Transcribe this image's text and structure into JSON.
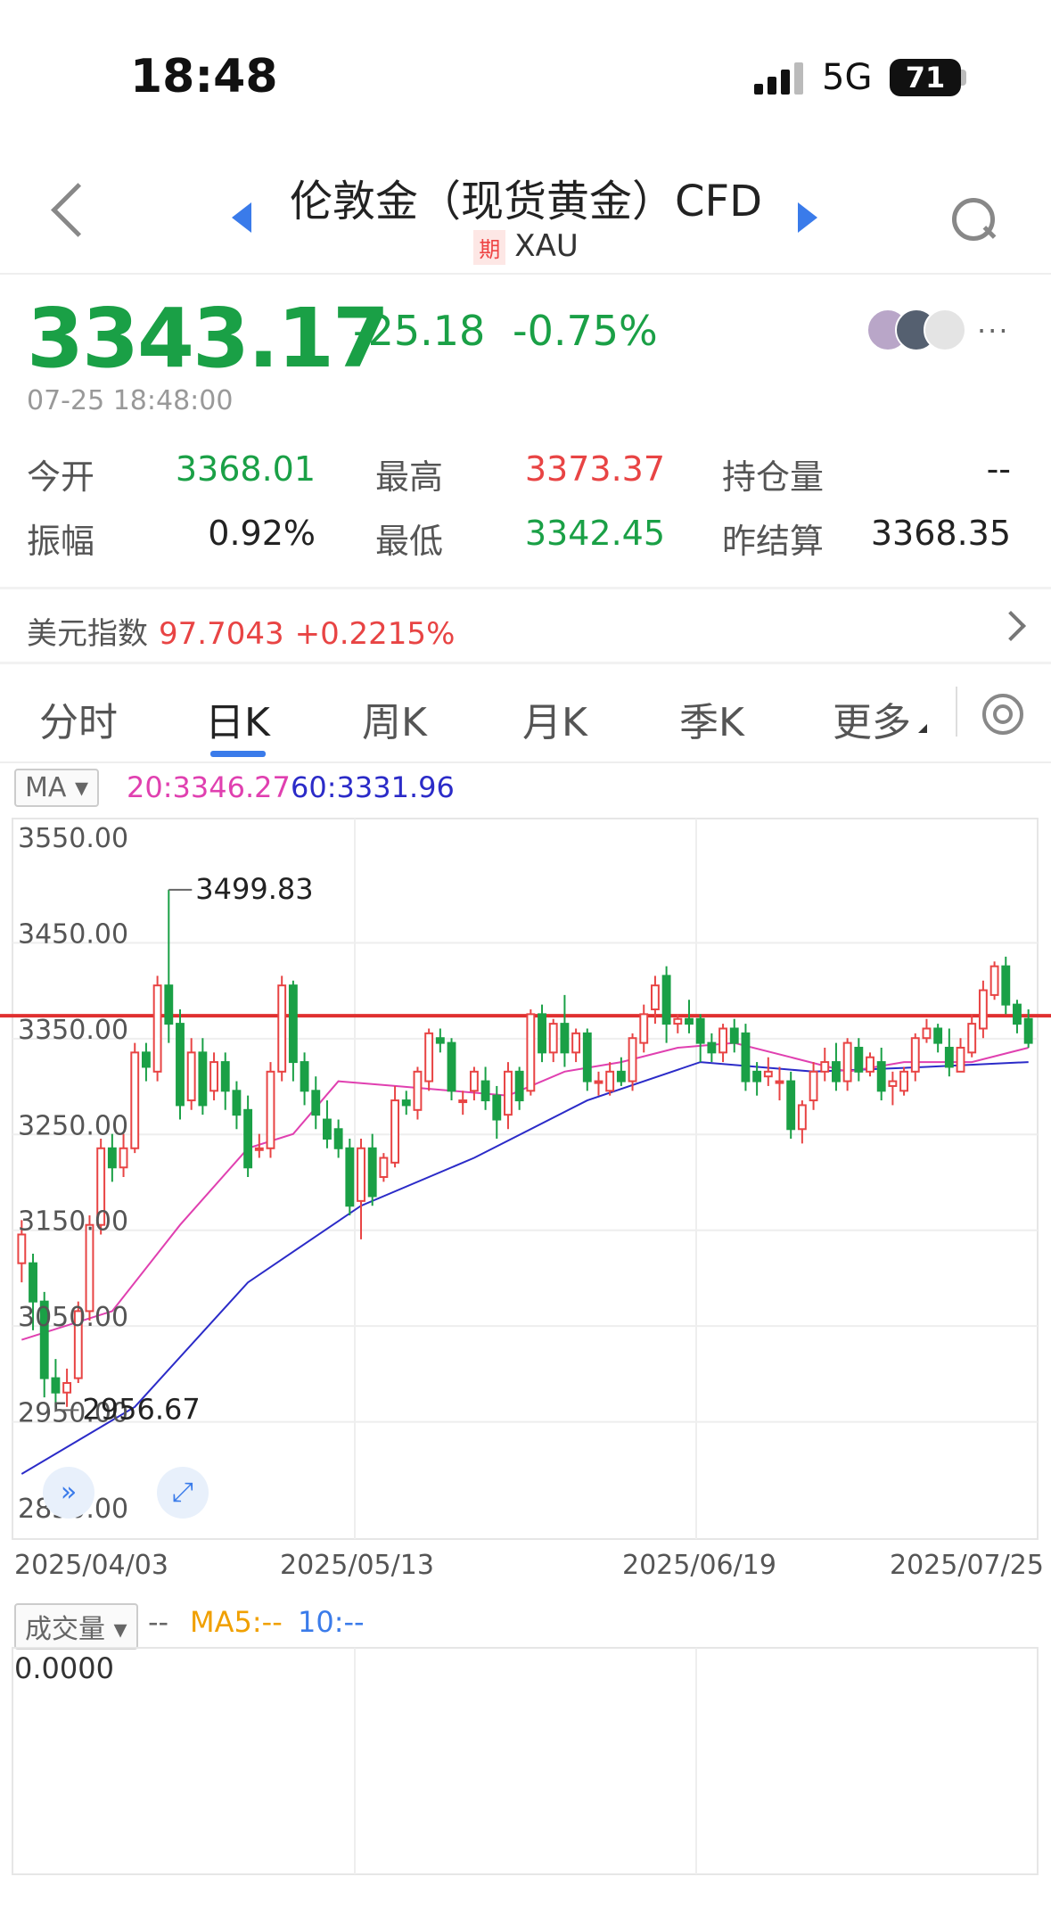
{
  "status_bar": {
    "time": "18:48",
    "network": "5G",
    "battery": "71"
  },
  "header": {
    "title": "伦敦金（现货黄金）CFD",
    "symbol_tag": "期",
    "symbol": "XAU"
  },
  "quote": {
    "price": "3343.17",
    "change": "-25.18",
    "change_pct": "-0.75%",
    "timestamp": "07-25 18:48:00",
    "more": "···"
  },
  "stats": [
    {
      "label": "今开",
      "value": "3368.01",
      "color": "green"
    },
    {
      "label": "最高",
      "value": "3373.37",
      "color": "red"
    },
    {
      "label": "持仓量",
      "value": "--",
      "color": "dark"
    },
    {
      "label": "振幅",
      "value": "0.92%",
      "color": "dark"
    },
    {
      "label": "最低",
      "value": "3342.45",
      "color": "green"
    },
    {
      "label": "昨结算",
      "value": "3368.35",
      "color": "dark"
    }
  ],
  "usd_index": {
    "label": "美元指数",
    "value": "97.7043",
    "change": "+0.2215%"
  },
  "tabs": [
    "分时",
    "日K",
    "周K",
    "月K",
    "季K",
    "更多"
  ],
  "active_tab": "日K",
  "ma_legend": {
    "selector": "MA",
    "ma20": "20:3346.27",
    "ma60": "60:3331.96"
  },
  "volume_legend": {
    "selector": "成交量",
    "dash": "--",
    "ma5": "MA5:--",
    "ma10": "10:--",
    "zero": "0.0000"
  },
  "colors": {
    "up": "#e84444",
    "down": "#1aa046",
    "ma20": "#e040b0",
    "ma60": "#2b2bc8",
    "accent": "#3a7bea",
    "ref_line": "#e03030"
  },
  "chart_data": {
    "type": "candlestick",
    "y_tick_labels": [
      "3550.00",
      "3450.00",
      "3350.00",
      "3250.00",
      "3150.00",
      "3050.00",
      "2950.00",
      "2850.00"
    ],
    "y_ticks": [
      3550,
      3450,
      3350,
      3250,
      3150,
      3050,
      2950,
      2850
    ],
    "ylim": [
      2850,
      3550
    ],
    "x_labels": [
      "2025/04/03",
      "2025/05/13",
      "2025/06/19",
      "2025/07/25"
    ],
    "annotations": [
      {
        "text": "3499.83",
        "value": 3499.83
      },
      {
        "text": "2956.67",
        "value": 2956.67
      }
    ],
    "reference_line": 3368.35,
    "candles": [
      [
        3110,
        3140,
        3090,
        3155
      ],
      [
        3110,
        3070,
        3040,
        3120
      ],
      [
        3070,
        2990,
        2970,
        3080
      ],
      [
        2990,
        2975,
        2960,
        3010
      ],
      [
        2975,
        2985,
        2960,
        3000
      ],
      [
        2990,
        3060,
        2985,
        3070
      ],
      [
        3060,
        3150,
        3050,
        3160
      ],
      [
        3150,
        3230,
        3140,
        3240
      ],
      [
        3230,
        3210,
        3195,
        3245
      ],
      [
        3210,
        3230,
        3200,
        3245
      ],
      [
        3230,
        3330,
        3225,
        3340
      ],
      [
        3330,
        3315,
        3300,
        3340
      ],
      [
        3310,
        3400,
        3300,
        3410
      ],
      [
        3400,
        3360,
        3340,
        3500
      ],
      [
        3360,
        3275,
        3260,
        3375
      ],
      [
        3280,
        3330,
        3270,
        3345
      ],
      [
        3330,
        3275,
        3265,
        3345
      ],
      [
        3290,
        3320,
        3280,
        3330
      ],
      [
        3320,
        3290,
        3270,
        3330
      ],
      [
        3290,
        3265,
        3250,
        3300
      ],
      [
        3270,
        3210,
        3200,
        3285
      ],
      [
        3230,
        3230,
        3220,
        3245
      ],
      [
        3230,
        3310,
        3220,
        3320
      ],
      [
        3310,
        3400,
        3300,
        3410
      ],
      [
        3400,
        3320,
        3300,
        3405
      ],
      [
        3320,
        3290,
        3275,
        3330
      ],
      [
        3290,
        3265,
        3250,
        3305
      ],
      [
        3260,
        3240,
        3230,
        3280
      ],
      [
        3250,
        3230,
        3220,
        3260
      ],
      [
        3230,
        3170,
        3160,
        3240
      ],
      [
        3175,
        3230,
        3135,
        3240
      ],
      [
        3230,
        3180,
        3170,
        3245
      ],
      [
        3200,
        3220,
        3195,
        3225
      ],
      [
        3215,
        3280,
        3210,
        3295
      ],
      [
        3280,
        3275,
        3265,
        3290
      ],
      [
        3270,
        3310,
        3260,
        3315
      ],
      [
        3300,
        3350,
        3290,
        3355
      ],
      [
        3345,
        3340,
        3330,
        3355
      ],
      [
        3340,
        3290,
        3280,
        3345
      ],
      [
        3280,
        3280,
        3265,
        3290
      ],
      [
        3290,
        3310,
        3280,
        3315
      ],
      [
        3300,
        3280,
        3270,
        3315
      ],
      [
        3285,
        3260,
        3240,
        3295
      ],
      [
        3265,
        3310,
        3250,
        3320
      ],
      [
        3310,
        3280,
        3270,
        3315
      ],
      [
        3290,
        3370,
        3285,
        3375
      ],
      [
        3370,
        3330,
        3320,
        3380
      ],
      [
        3330,
        3360,
        3320,
        3365
      ],
      [
        3360,
        3330,
        3315,
        3390
      ],
      [
        3330,
        3350,
        3320,
        3355
      ],
      [
        3350,
        3300,
        3290,
        3355
      ],
      [
        3300,
        3300,
        3285,
        3310
      ],
      [
        3290,
        3310,
        3285,
        3320
      ],
      [
        3310,
        3300,
        3295,
        3325
      ],
      [
        3300,
        3345,
        3290,
        3350
      ],
      [
        3340,
        3370,
        3330,
        3380
      ],
      [
        3375,
        3400,
        3360,
        3410
      ],
      [
        3410,
        3360,
        3340,
        3420
      ],
      [
        3360,
        3365,
        3350,
        3370
      ],
      [
        3365,
        3360,
        3350,
        3385
      ],
      [
        3365,
        3340,
        3320,
        3370
      ],
      [
        3340,
        3330,
        3320,
        3350
      ],
      [
        3330,
        3355,
        3320,
        3360
      ],
      [
        3355,
        3340,
        3330,
        3365
      ],
      [
        3350,
        3300,
        3290,
        3360
      ],
      [
        3310,
        3300,
        3285,
        3320
      ],
      [
        3305,
        3310,
        3295,
        3325
      ],
      [
        3300,
        3300,
        3280,
        3315
      ],
      [
        3300,
        3250,
        3240,
        3310
      ],
      [
        3250,
        3275,
        3235,
        3280
      ],
      [
        3280,
        3310,
        3270,
        3320
      ],
      [
        3310,
        3320,
        3300,
        3335
      ],
      [
        3320,
        3300,
        3290,
        3340
      ],
      [
        3300,
        3340,
        3290,
        3345
      ],
      [
        3335,
        3310,
        3300,
        3345
      ],
      [
        3310,
        3325,
        3305,
        3330
      ],
      [
        3320,
        3290,
        3280,
        3335
      ],
      [
        3295,
        3300,
        3275,
        3310
      ],
      [
        3290,
        3310,
        3285,
        3315
      ],
      [
        3310,
        3345,
        3300,
        3350
      ],
      [
        3345,
        3355,
        3340,
        3365
      ],
      [
        3355,
        3340,
        3330,
        3360
      ],
      [
        3335,
        3315,
        3305,
        3355
      ],
      [
        3310,
        3335,
        3310,
        3345
      ],
      [
        3330,
        3360,
        3325,
        3370
      ],
      [
        3355,
        3395,
        3345,
        3405
      ],
      [
        3390,
        3420,
        3385,
        3425
      ],
      [
        3420,
        3380,
        3370,
        3430
      ],
      [
        3380,
        3360,
        3350,
        3385
      ],
      [
        3365,
        3340,
        3335,
        3375
      ]
    ],
    "ma20": [
      [
        0,
        3030
      ],
      [
        8,
        3060
      ],
      [
        14,
        3150
      ],
      [
        20,
        3230
      ],
      [
        24,
        3245
      ],
      [
        28,
        3300
      ],
      [
        33,
        3295
      ],
      [
        38,
        3290
      ],
      [
        43,
        3285
      ],
      [
        48,
        3310
      ],
      [
        53,
        3320
      ],
      [
        58,
        3335
      ],
      [
        63,
        3340
      ],
      [
        68,
        3325
      ],
      [
        73,
        3310
      ],
      [
        78,
        3320
      ],
      [
        84,
        3320
      ],
      [
        89,
        3335
      ]
    ],
    "ma60": [
      [
        0,
        2890
      ],
      [
        10,
        2960
      ],
      [
        20,
        3090
      ],
      [
        30,
        3170
      ],
      [
        40,
        3220
      ],
      [
        50,
        3280
      ],
      [
        60,
        3320
      ],
      [
        70,
        3310
      ],
      [
        80,
        3315
      ],
      [
        89,
        3320
      ]
    ]
  }
}
